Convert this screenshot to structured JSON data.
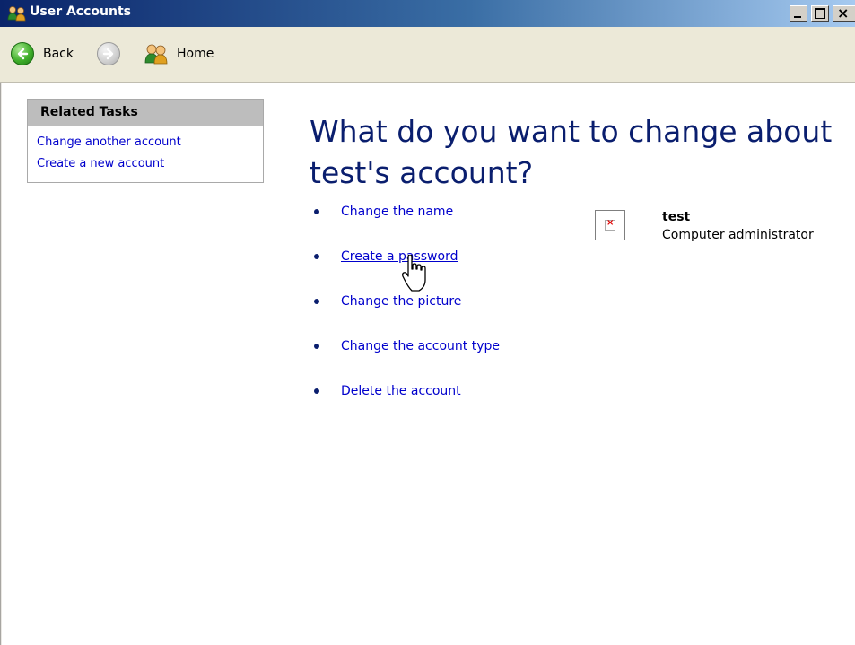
{
  "window": {
    "title": "User Accounts",
    "icon": "users-icon",
    "controls": {
      "minimize": "minimize-icon",
      "maximize": "maximize-icon",
      "close": "close-icon"
    }
  },
  "toolbar": {
    "back_label": "Back",
    "forward_icon": "forward-arrow-icon",
    "home_label": "Home"
  },
  "related_tasks": {
    "header": "Related Tasks",
    "links": [
      "Change another account",
      "Create a new account"
    ]
  },
  "main": {
    "title": "What do you want to change about test's account?",
    "actions": [
      "Change the name",
      "Create a password",
      "Change the picture",
      "Change the account type",
      "Delete the account"
    ],
    "hovered_action": "Create a password"
  },
  "account": {
    "name": "test",
    "type": "Computer administrator",
    "picture_icon": "broken-image-icon"
  },
  "colors": {
    "title_text": "#0a1e6e",
    "link": "#0000cc",
    "titlebar_start": "#0a246a",
    "titlebar_end": "#a6caf0"
  }
}
